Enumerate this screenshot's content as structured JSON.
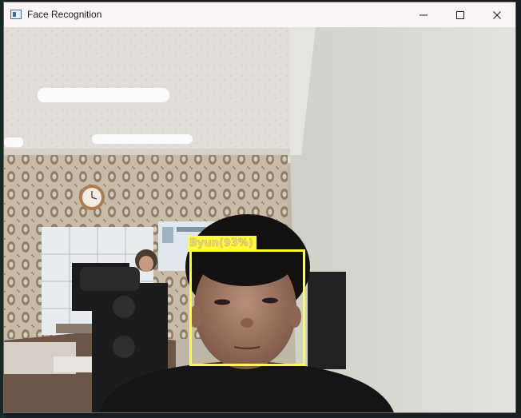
{
  "window": {
    "title": "Face Recognition",
    "controls": {
      "minimize": "minimize-icon",
      "maximize": "maximize-icon",
      "close": "close-icon"
    }
  },
  "detection": {
    "label": "Byun(93%)",
    "box_color": "#ffff33"
  },
  "colors": {
    "titlebar": "#fbf5f5",
    "box": "#ffff33"
  }
}
